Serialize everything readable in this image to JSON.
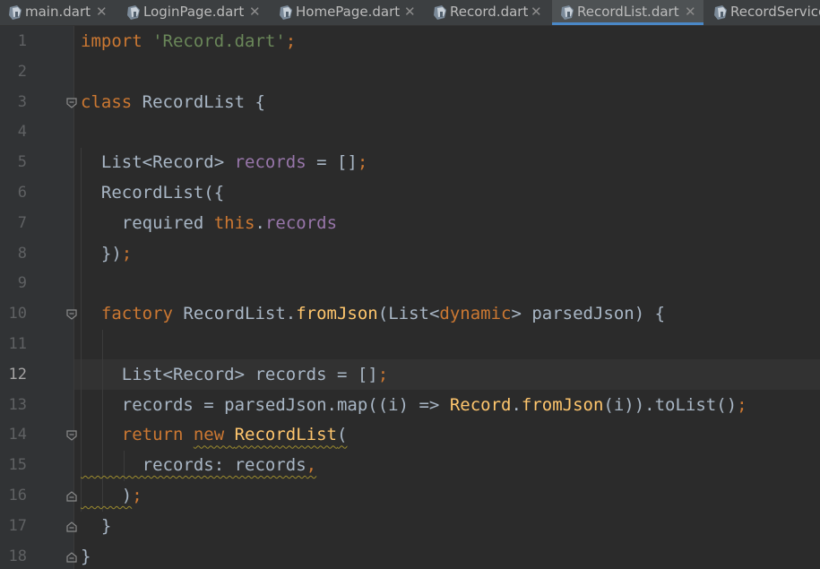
{
  "tabs": [
    {
      "label": "main.dart",
      "active": false
    },
    {
      "label": "LoginPage.dart",
      "active": false
    },
    {
      "label": "HomePage.dart",
      "active": false
    },
    {
      "label": "Record.dart",
      "active": false
    },
    {
      "label": "RecordList.dart",
      "active": true
    },
    {
      "label": "RecordService",
      "active": false
    }
  ],
  "close_glyph": "✕",
  "current_line": 12,
  "lines": [
    {
      "number": "1",
      "tokens": [
        {
          "t": "import ",
          "c": "kw"
        },
        {
          "t": "'Record.dart'",
          "c": "str"
        },
        {
          "t": ";",
          "c": "kw"
        }
      ]
    },
    {
      "number": "2",
      "tokens": []
    },
    {
      "number": "3",
      "tokens": [
        {
          "t": "class ",
          "c": "kw"
        },
        {
          "t": "RecordList {",
          "c": "plain"
        }
      ]
    },
    {
      "number": "4",
      "tokens": []
    },
    {
      "number": "5",
      "tokens": [
        {
          "t": "  List<Record> ",
          "c": "plain"
        },
        {
          "t": "records",
          "c": "field"
        },
        {
          "t": " = []",
          "c": "plain"
        },
        {
          "t": ";",
          "c": "kw"
        }
      ]
    },
    {
      "number": "6",
      "tokens": [
        {
          "t": "  RecordList({",
          "c": "plain"
        }
      ]
    },
    {
      "number": "7",
      "tokens": [
        {
          "t": "    required ",
          "c": "plain"
        },
        {
          "t": "this",
          "c": "kw"
        },
        {
          "t": ".",
          "c": "plain"
        },
        {
          "t": "records",
          "c": "field"
        }
      ]
    },
    {
      "number": "8",
      "tokens": [
        {
          "t": "  })",
          "c": "plain"
        },
        {
          "t": ";",
          "c": "kw"
        }
      ]
    },
    {
      "number": "9",
      "tokens": []
    },
    {
      "number": "10",
      "tokens": [
        {
          "t": "  factory ",
          "c": "kw"
        },
        {
          "t": "RecordList.",
          "c": "plain"
        },
        {
          "t": "fromJson",
          "c": "fn"
        },
        {
          "t": "(List<",
          "c": "plain"
        },
        {
          "t": "dynamic",
          "c": "kw"
        },
        {
          "t": "> parsedJson) {",
          "c": "plain"
        }
      ]
    },
    {
      "number": "11",
      "tokens": []
    },
    {
      "number": "12",
      "tokens": [
        {
          "t": "    List<Record> records = []",
          "c": "plain"
        },
        {
          "t": ";",
          "c": "kw"
        }
      ]
    },
    {
      "number": "13",
      "tokens": [
        {
          "t": "    records = parsedJson.map((i) => ",
          "c": "plain"
        },
        {
          "t": "Record",
          "c": "fn"
        },
        {
          "t": ".",
          "c": "plain"
        },
        {
          "t": "fromJson",
          "c": "fn"
        },
        {
          "t": "(i)).toList()",
          "c": "plain"
        },
        {
          "t": ";",
          "c": "kw"
        }
      ]
    },
    {
      "number": "14",
      "tokens": [
        {
          "t": "    return ",
          "c": "kw"
        },
        {
          "t": "new ",
          "c": "kw sq"
        },
        {
          "t": "RecordList",
          "c": "fn sq"
        },
        {
          "t": "(",
          "c": "plain sq"
        }
      ]
    },
    {
      "number": "15",
      "tokens": [
        {
          "t": "      records: records",
          "c": "plain sq"
        },
        {
          "t": ",",
          "c": "kw sq"
        }
      ]
    },
    {
      "number": "16",
      "tokens": [
        {
          "t": "    )",
          "c": "plain sq"
        },
        {
          "t": ";",
          "c": "kw"
        }
      ]
    },
    {
      "number": "17",
      "tokens": [
        {
          "t": "  }",
          "c": "plain"
        }
      ]
    },
    {
      "number": "18",
      "tokens": [
        {
          "t": "}",
          "c": "plain"
        }
      ]
    }
  ],
  "colors": {
    "background": "#2b2b2b",
    "gutter": "#313335",
    "keyword": "#cc7832",
    "string": "#6a8759",
    "field": "#9876aa",
    "function": "#ffc66d",
    "plain": "#a9b7c6",
    "active_tab_underline": "#4a88c7"
  },
  "icons": {
    "tab_file": "dart-file-icon",
    "fold": "fold-marker-icon",
    "close": "close-icon"
  }
}
